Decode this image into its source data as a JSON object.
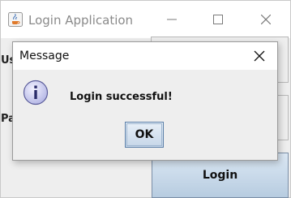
{
  "main_window": {
    "title": "Login Application",
    "user_label_partial": "Us",
    "password_label_partial": "Pa",
    "login_button": "Login"
  },
  "dialog": {
    "title": "Message",
    "message": "Login successful!",
    "ok_button": "OK"
  },
  "icons": {
    "app": "java-cup-icon",
    "info": "information-icon",
    "minimize": "minimize-icon",
    "maximize": "maximize-icon",
    "close": "close-icon"
  },
  "colors": {
    "info_icon_fill": "#c6c8ee",
    "button_gradient_top": "#dce8f4",
    "button_gradient_bottom": "#b7cce0"
  }
}
